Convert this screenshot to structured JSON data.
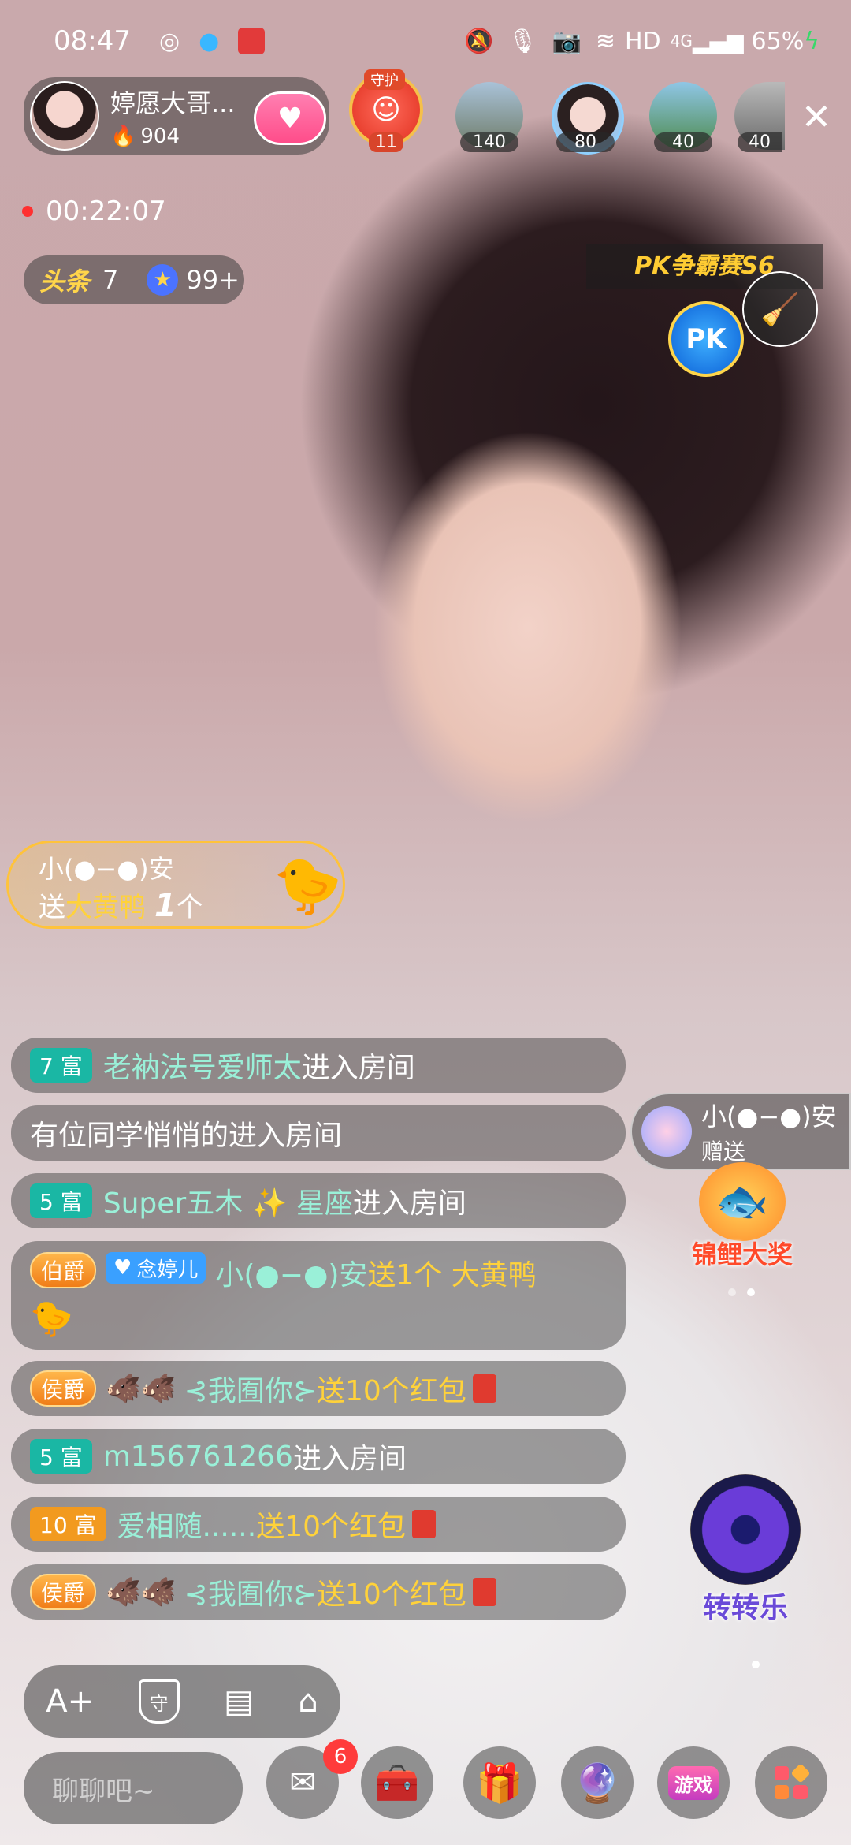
{
  "status": {
    "time": "08:47",
    "network": "HD",
    "signal": "4G",
    "battery": "65%"
  },
  "host": {
    "name": "婷愿大哥...",
    "fans": "904"
  },
  "guard": {
    "label": "守护",
    "count": "11"
  },
  "viewers": [
    {
      "value": "140"
    },
    {
      "value": "80"
    },
    {
      "value": "40"
    },
    {
      "value": "40"
    }
  ],
  "live": {
    "elapsed": "00:22:07"
  },
  "badges": {
    "headline_label": "头条",
    "headline_count": "7",
    "star_count": "99+"
  },
  "pk": {
    "banner": "PK争霸赛S6",
    "label": "PK"
  },
  "gift_banner": {
    "user": "小(●−●)安",
    "action": "送",
    "gift": "大黄鸭",
    "count": "1",
    "unit": "个"
  },
  "side_gift": {
    "user": "小(●−●)安",
    "action": "赠送"
  },
  "prize_label": "锦鲤大奖",
  "spin_label": "转转乐",
  "messages": [
    {
      "badge": "7 富",
      "name": "老衲法号爱师太",
      "text": " 进入房间"
    },
    {
      "text": "有位同学悄悄的进入房间"
    },
    {
      "badge": "5 富",
      "name": "Super五木 ✨ 星座",
      "text": " 进入房间"
    },
    {
      "rank": "伯爵",
      "fan": "念婷儿",
      "name": "小(●−●)安",
      "text": " 送1个 大黄鸭"
    },
    {
      "rank": "侯爵",
      "name": "⊰我囿你⊱",
      "text": " 送10个红包"
    },
    {
      "badge": "5 富",
      "name": "m156761266",
      "text": " 进入房间"
    },
    {
      "badge": "10 富",
      "name": "爱相随......",
      "text": " 送10个红包"
    },
    {
      "rank": "侯爵",
      "name": "⊰我囿你⊱",
      "text": " 送10个红包"
    }
  ],
  "toolbar": {
    "font_icon": "A+",
    "guard_icon": "守"
  },
  "input": {
    "placeholder": "聊聊吧~"
  },
  "mail": {
    "badge": "6"
  },
  "game_label": "游戏"
}
